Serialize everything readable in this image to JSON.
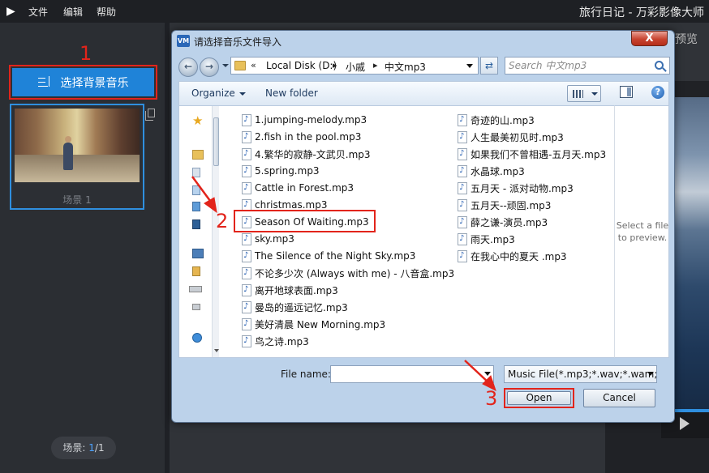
{
  "app": {
    "menu": [
      "文件",
      "编辑",
      "帮助"
    ],
    "title": "旅行日记 - 万彩影像大师",
    "preview_label": "预览"
  },
  "sidebar": {
    "bgm_button_label": "选择背景音乐",
    "scene_label": "场景 1",
    "scene_counter_prefix": "场景: ",
    "scene_current": "1",
    "scene_total_sep": "/1"
  },
  "annotations": [
    "1",
    "2",
    "3"
  ],
  "dialog": {
    "title": "请选择音乐文件导入",
    "app_icon_text": "VM",
    "close_label": "X",
    "breadcrumb": [
      "Local Disk (D:)",
      "小戚",
      "中文mp3"
    ],
    "breadcrumb_prefix": "«",
    "search_placeholder": "Search 中文mp3",
    "toolbar": {
      "organize": "Organize",
      "new_folder": "New folder",
      "help": "?"
    },
    "files_col1": [
      "1.jumping-melody.mp3",
      "2.fish in the pool.mp3",
      "4.繁华的寂静-文武贝.mp3",
      "5.spring.mp3",
      "Cattle in Forest.mp3",
      "christmas.mp3",
      "Season Of Waiting.mp3",
      "sky.mp3",
      "The Silence of the Night Sky.mp3",
      "不论多少次 (Always with me) - 八音盒.mp3",
      "离开地球表面.mp3",
      "曼岛的遥远记忆.mp3",
      "美好清晨 New Morning.mp3",
      "鸟之诗.mp3"
    ],
    "files_col2": [
      "奇迹的山.mp3",
      "人生最美初见时.mp3",
      "如果我们不曾相遇-五月天.mp3",
      "水晶球.mp3",
      "五月天 - 派对动物.mp3",
      "五月天--顽固.mp3",
      "薛之谦-演员.mp3",
      "雨天.mp3",
      "在我心中的夏天 .mp3"
    ],
    "preview_text": [
      "Select a file",
      "to preview."
    ],
    "filename_label": "File name:",
    "filename_value": "",
    "filetype": "Music File(*.mp3;*.wav;*.wam;*",
    "open_label": "Open",
    "cancel_label": "Cancel"
  },
  "colors": {
    "accent_blue": "#1f83d8",
    "annotation_red": "#e2241b"
  }
}
